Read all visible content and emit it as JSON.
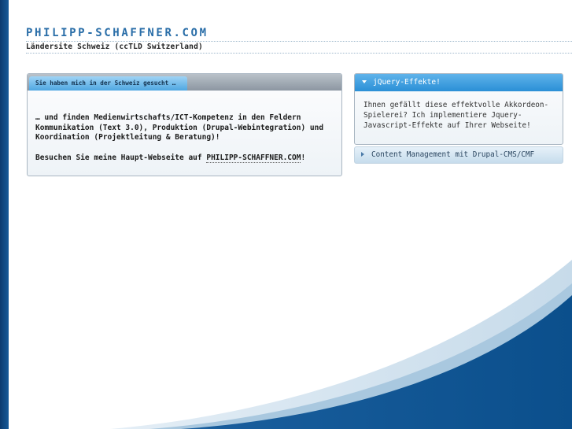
{
  "header": {
    "title": "PHILIPP-SCHAFFNER.COM",
    "subtitle": "Ländersite Schweiz (ccTLD Switzerland)"
  },
  "main_panel": {
    "tab_label": "Sie haben mich in der Schweiz gesucht …",
    "paragraph1": "… und finden Medienwirtschafts/ICT-Kompetenz in den Feldern Kommunikation (Text 3.0), Produktion (Drupal-Webintegration) und Koordination (Projektleitung & Beratung)!",
    "paragraph2_prefix": "Besuchen Sie meine Haupt-Webseite auf ",
    "paragraph2_link": "PHILIPP-SCHAFFNER.COM",
    "paragraph2_suffix": "!"
  },
  "accordion": {
    "items": [
      {
        "label": "jQuery-Effekte!",
        "expanded": true,
        "content": "Ihnen gefällt diese effektvolle Akkordeon-Spielerei? Ich implementiere Jquery-Javascript-Effekte auf Ihrer Webseite!"
      },
      {
        "label": "Content Management mit Drupal-CMS/CMF",
        "expanded": false
      }
    ]
  },
  "colors": {
    "brand_blue": "#2a6ea8",
    "accordion_active": "#3d9ee0",
    "left_bar": "#0c3b6e"
  }
}
